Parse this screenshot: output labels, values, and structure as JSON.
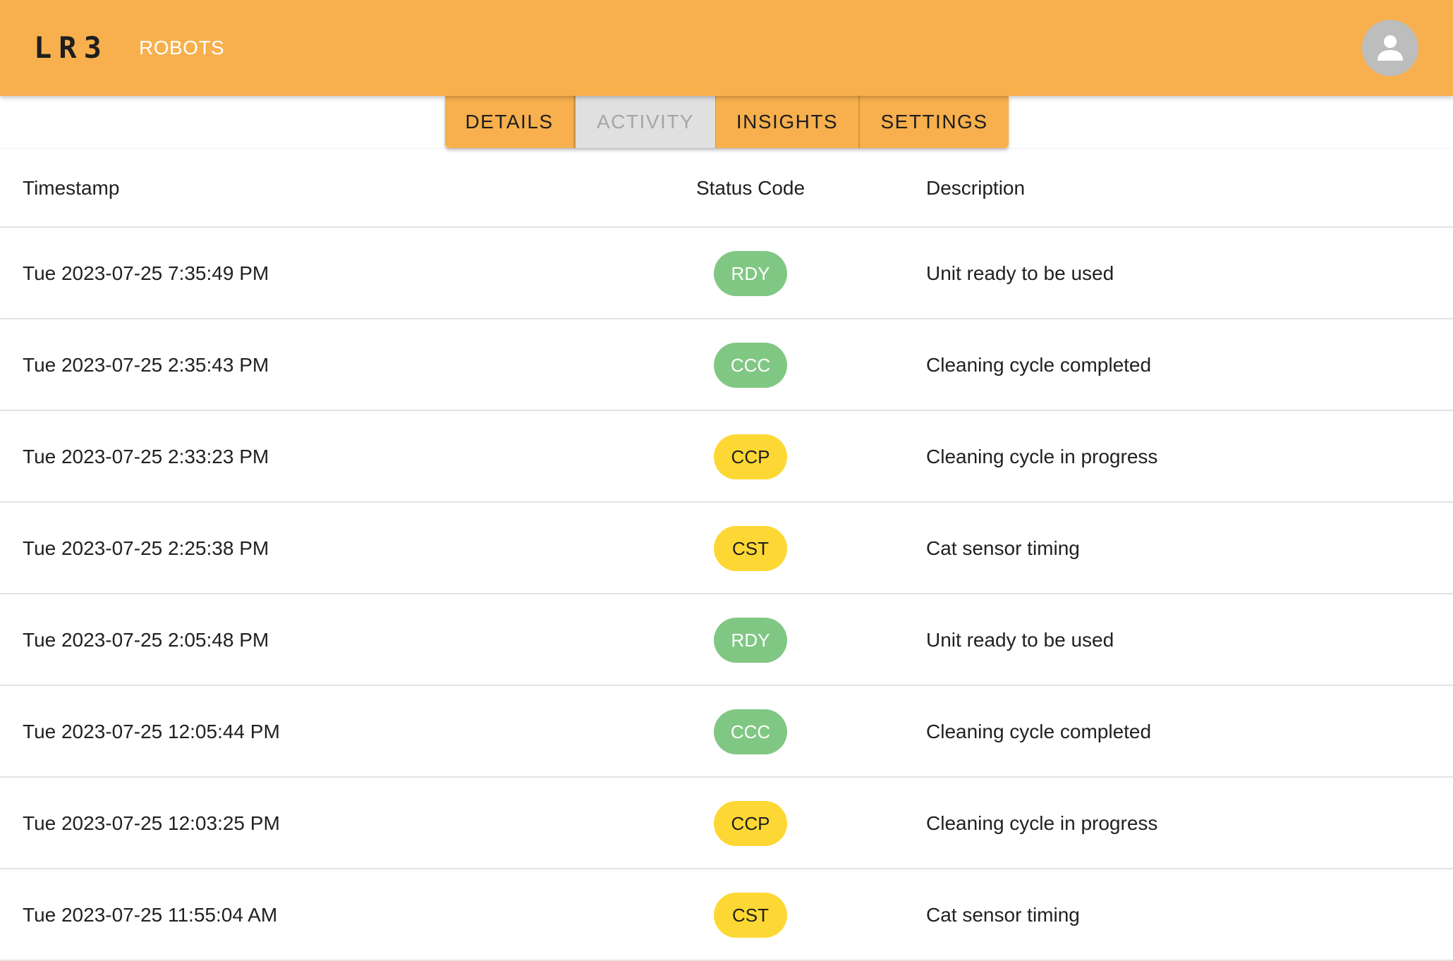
{
  "app": {
    "logo": "LR3",
    "nav_link": "ROBOTS"
  },
  "tabs": [
    {
      "label": "DETAILS",
      "active": false
    },
    {
      "label": "ACTIVITY",
      "active": true
    },
    {
      "label": "INSIGHTS",
      "active": false
    },
    {
      "label": "SETTINGS",
      "active": false
    }
  ],
  "table": {
    "headers": {
      "timestamp": "Timestamp",
      "status": "Status Code",
      "description": "Description"
    },
    "rows": [
      {
        "timestamp": "Tue 2023-07-25 7:35:49 PM",
        "code": "RDY",
        "color": "green",
        "description": "Unit ready to be used"
      },
      {
        "timestamp": "Tue 2023-07-25 2:35:43 PM",
        "code": "CCC",
        "color": "green",
        "description": "Cleaning cycle completed"
      },
      {
        "timestamp": "Tue 2023-07-25 2:33:23 PM",
        "code": "CCP",
        "color": "yellow",
        "description": "Cleaning cycle in progress"
      },
      {
        "timestamp": "Tue 2023-07-25 2:25:38 PM",
        "code": "CST",
        "color": "yellow",
        "description": "Cat sensor timing"
      },
      {
        "timestamp": "Tue 2023-07-25 2:05:48 PM",
        "code": "RDY",
        "color": "green",
        "description": "Unit ready to be used"
      },
      {
        "timestamp": "Tue 2023-07-25 12:05:44 PM",
        "code": "CCC",
        "color": "green",
        "description": "Cleaning cycle completed"
      },
      {
        "timestamp": "Tue 2023-07-25 12:03:25 PM",
        "code": "CCP",
        "color": "yellow",
        "description": "Cleaning cycle in progress"
      },
      {
        "timestamp": "Tue 2023-07-25 11:55:04 AM",
        "code": "CST",
        "color": "yellow",
        "description": "Cat sensor timing"
      }
    ]
  },
  "colors": {
    "appbar": "#f7b04d",
    "status_green": "#81c784",
    "status_yellow": "#fdd835"
  }
}
